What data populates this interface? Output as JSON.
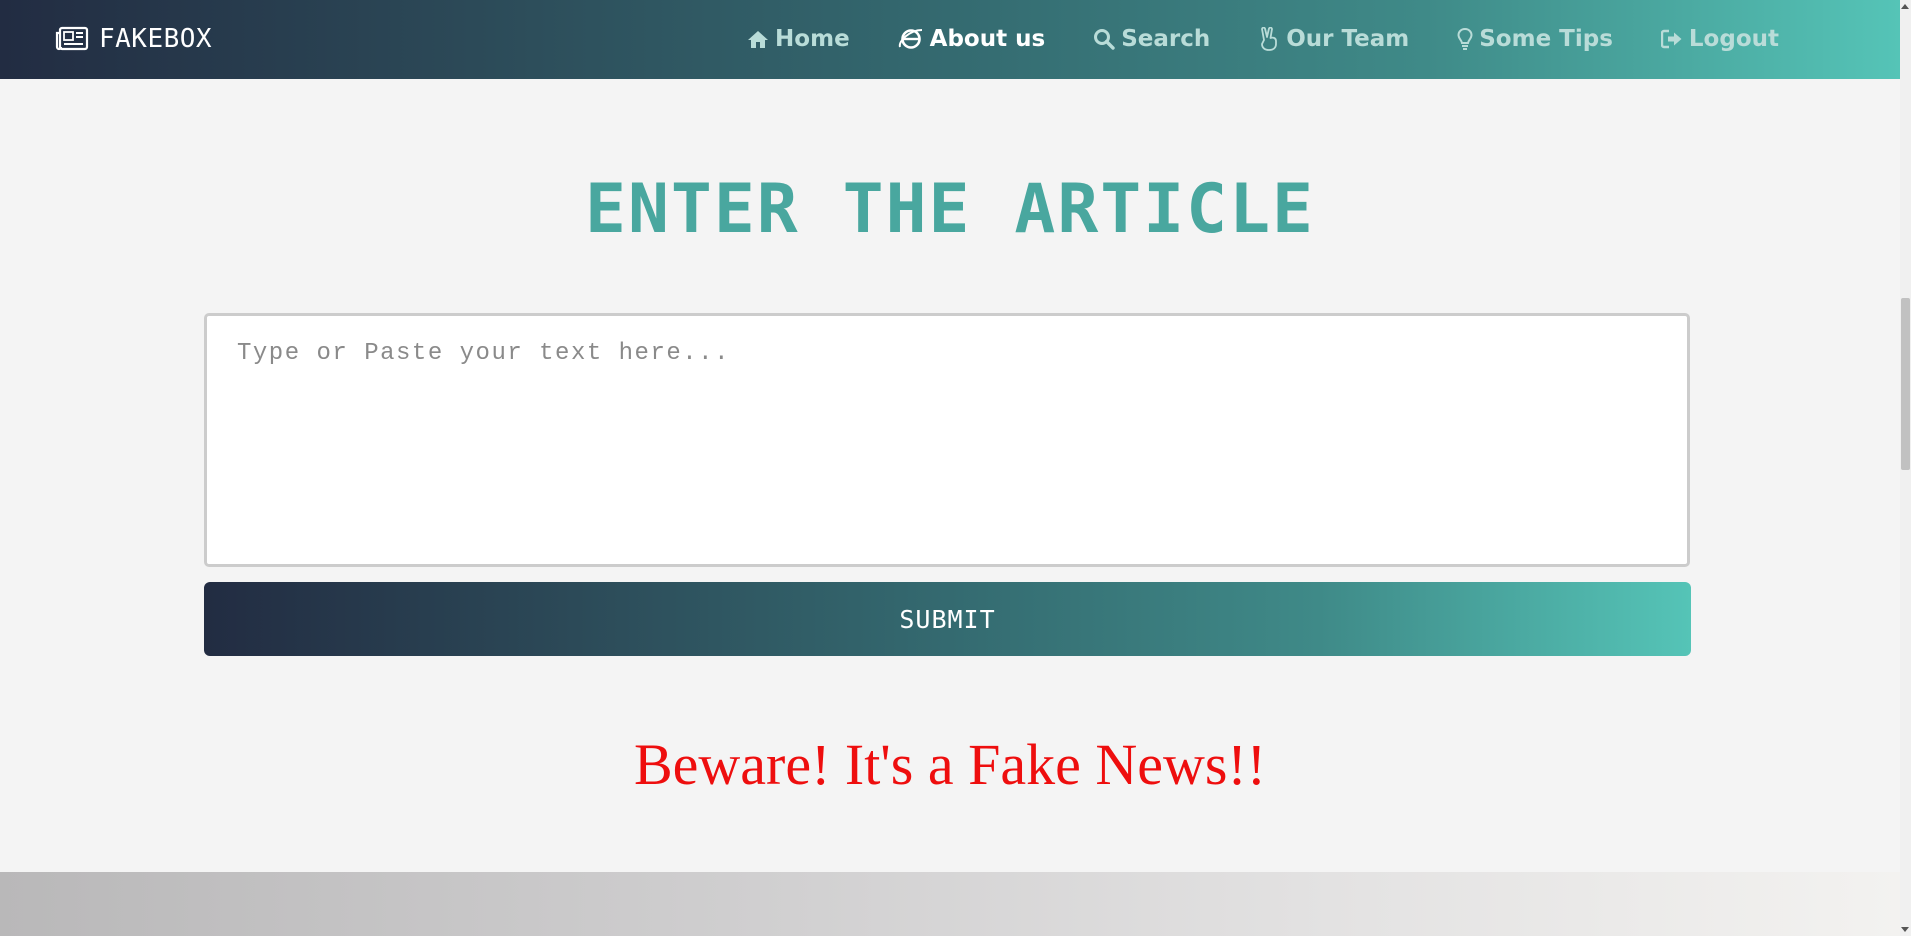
{
  "navbar": {
    "brand": "FAKEBOX",
    "brand_icon": "newspaper-icon",
    "items": [
      {
        "label": "Home",
        "icon": "home-icon",
        "active": false
      },
      {
        "label": "About us",
        "icon": "internet-explorer-icon",
        "active": true
      },
      {
        "label": "Search",
        "icon": "search-icon",
        "active": false
      },
      {
        "label": "Our Team",
        "icon": "hand-peace-icon",
        "active": false
      },
      {
        "label": "Some Tips",
        "icon": "lightbulb-icon",
        "active": false
      },
      {
        "label": "Logout",
        "icon": "sign-out-icon",
        "active": false
      }
    ]
  },
  "main": {
    "heading": "ENTER THE ARTICLE",
    "input": {
      "value": "",
      "placeholder": "Type or Paste your text here..."
    },
    "submit_label": "SUBMIT",
    "result_text": "Beware! It's a Fake News!!"
  },
  "colors": {
    "gradient_start": "#222c42",
    "gradient_end": "#55c4b7",
    "heading": "#49a79f",
    "result": "#ee0e0e",
    "background": "#f4f4f4"
  }
}
